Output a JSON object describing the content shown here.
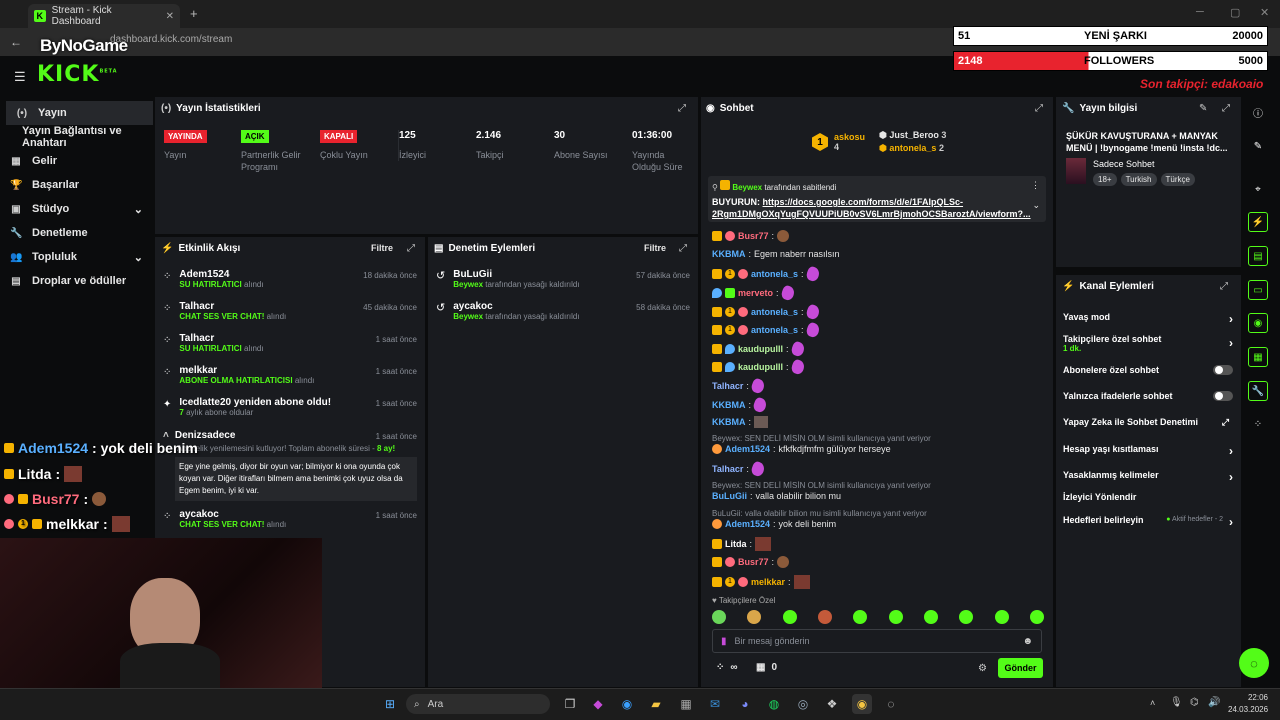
{
  "browser": {
    "tab_title": "Stream - Kick Dashboard",
    "url": "dashboard.kick.com/stream",
    "overlay_logo": "ByNoGame"
  },
  "overlay": {
    "song_count": "51",
    "song_label": "YENİ ŞARKI",
    "song_goal": "20000",
    "followers_count": "2148",
    "followers_label": "FOLLOWERS",
    "followers_goal": "5000",
    "last_follower": "Son takipçi: edakoaio"
  },
  "app": {
    "logo": "KICK",
    "logo_sup": "BETA"
  },
  "sidebar": {
    "items": [
      {
        "label": "Yayın",
        "icon": "(•)"
      },
      {
        "label": "Yayın Bağlantısı ve Anahtarı",
        "icon": ""
      },
      {
        "label": "Gelir",
        "icon": "▦"
      },
      {
        "label": "Başarılar",
        "icon": "🏆"
      },
      {
        "label": "Stüdyo",
        "icon": "▣"
      },
      {
        "label": "Denetleme",
        "icon": "🔧"
      },
      {
        "label": "Topluluk",
        "icon": "👥"
      },
      {
        "label": "Droplar ve ödüller",
        "icon": "▤"
      }
    ]
  },
  "stats": {
    "title": "Yayın İstatistikleri",
    "items": [
      {
        "badge": "YAYINDA",
        "label": "Yayın",
        "color": "#e8232e"
      },
      {
        "badge": "AÇIK",
        "label": "Partnerlik Gelir Programı",
        "color": "#53fc18"
      },
      {
        "badge": "KAPALI",
        "label": "Çoklu Yayın",
        "color": "#e8232e"
      },
      {
        "value": "125",
        "label": "İzleyici"
      },
      {
        "value": "2.146",
        "label": "Takipçi"
      },
      {
        "value": "30",
        "label": "Abone Sayısı"
      },
      {
        "value": "01:36:00",
        "label": "Yayında Olduğu Süre"
      }
    ]
  },
  "activity": {
    "title": "Etkinlik Akışı",
    "filter": "Filtre",
    "events": [
      {
        "name": "Adem1524",
        "sub": "SU HATIRLATICI",
        "suffix": "alındı",
        "time": "18 dakika önce"
      },
      {
        "name": "Talhacr",
        "sub": "CHAT SES VER CHAT!",
        "suffix": "alındı",
        "time": "45 dakika önce"
      },
      {
        "name": "Talhacr",
        "sub": "SU HATIRLATICI",
        "suffix": "alındı",
        "time": "1 saat önce"
      },
      {
        "name": "melkkar",
        "sub": "ABONE OLMA HATIRLATICISI",
        "suffix": "alındı",
        "time": "1 saat önce"
      },
      {
        "name": "Icedlatte20 yeniden abone oldu!",
        "sub": "7",
        "suffix": "aylık abone oldular",
        "time": "1 saat önce"
      }
    ],
    "resub": {
      "name": "Denizsadece",
      "time": "1 saat önce",
      "text": "Abonelik yenilemesini kutluyor! Toplam abonelik süresi -",
      "months": "8 ay!",
      "message": "Ege yine gelmiş, diyor bir oyun var; bilmiyor ki ona oyunda çok koyan var. Diğer itirafları bilmem ama benimki çok uyuz olsa da Egem benim, iyi ki var."
    },
    "last": {
      "name": "aycakoc",
      "sub": "CHAT SES VER CHAT!",
      "suffix": "alındı",
      "time": "1 saat önce"
    }
  },
  "moderation": {
    "title": "Denetim Eylemleri",
    "filter": "Filtre",
    "events": [
      {
        "name": "BuLuGii",
        "by": "Beywex",
        "suffix": "tarafından yasağı kaldırıldı",
        "time": "57 dakika önce"
      },
      {
        "name": "aycakoc",
        "by": "Beywex",
        "suffix": "tarafından yasağı kaldırıldı",
        "time": "58 dakika önce"
      }
    ]
  },
  "chat": {
    "title": "Sohbet",
    "top": [
      {
        "rank": "1",
        "name": "askosu",
        "count": "4"
      },
      {
        "name": "Just_Beroo",
        "count": "3"
      },
      {
        "name": "antonela_s",
        "count": "2"
      }
    ],
    "pinned_by": "Beywex",
    "pinned_suffix": "tarafından sabitlendi",
    "pinned_prefix": "BUYURUN:",
    "pinned_link": "https://docs.google.com/forms/d/e/1FAIpQLSc-2Rgm1DMgOXqYugFQVUUPiUB0vSV6LmrBjmohOCSBaroztA/viewform?...",
    "messages": [
      {
        "user": "Busr77",
        "color": "#ff6b7d",
        "text": ""
      },
      {
        "user": "KKBMA",
        "color": "#5ab0ff",
        "text": "Egem naberr nasılsın"
      },
      {
        "user": "antonela_s",
        "color": "#5ab0ff",
        "text": ""
      },
      {
        "user": "merveto",
        "color": "#ff6b7d",
        "text": ""
      },
      {
        "user": "antonela_s",
        "color": "#5ab0ff",
        "text": ""
      },
      {
        "user": "antonela_s",
        "color": "#5ab0ff",
        "text": ""
      },
      {
        "user": "kaudupulll",
        "color": "#b8f5a0",
        "text": ""
      },
      {
        "user": "kaudupulll",
        "color": "#b8f5a0",
        "text": ""
      },
      {
        "user": "Talhacr",
        "color": "#8fb4ff",
        "text": ""
      },
      {
        "user": "KKBMA",
        "color": "#5ab0ff",
        "text": ""
      },
      {
        "user": "KKBMA",
        "color": "#5ab0ff",
        "text": ""
      }
    ],
    "reply1": "Beywex: SEN DELİ MİSİN OLM isimli kullanıcıya yanıt veriyor",
    "msg_adem1": {
      "user": "Adem1524",
      "text": "kfkfkdjfmfm gülüyor herseye"
    },
    "msg_talha": {
      "user": "Talhacr",
      "text": ""
    },
    "reply2": "Beywex: SEN DELİ MİSİN OLM isimli kullanıcıya yanıt veriyor",
    "msg_bulu": {
      "user": "BuLuGii",
      "text": "valla olabilir bilion mu"
    },
    "reply3": "BuLuGii: valla olabilir bilion mu isimli kullanıcıya yanıt veriyor",
    "msg_adem2": {
      "user": "Adem1524",
      "text": "yok deli benim"
    },
    "msg_litda": {
      "user": "Litda",
      "text": ""
    },
    "msg_busr": {
      "user": "Busr77",
      "text": ""
    },
    "msg_melk": {
      "user": "melkkar",
      "text": ""
    },
    "followers_only": "Takipçilere Özel",
    "input_placeholder": "Bir mesaj gönderin",
    "points": "∞",
    "gifts": "0",
    "send": "Gönder"
  },
  "stream_info": {
    "title": "Yayın bilgisi",
    "stream_title": "ŞÜKÜR KAVUŞTURANA + MANYAK MENÜ | !bynogame !menü !insta !dc...",
    "category": "Sadece Sohbet",
    "tags": [
      "18+",
      "Turkish",
      "Türkçe"
    ]
  },
  "channel_actions": {
    "title": "Kanal Eylemleri",
    "items": [
      {
        "label": "Yavaş mod",
        "kind": "chevron"
      },
      {
        "label": "Takipçilere özel sohbet",
        "sub": "1 dk.",
        "kind": "chevron"
      },
      {
        "label": "Abonelere özel sohbet",
        "kind": "toggle"
      },
      {
        "label": "Yalnızca ifadelerle sohbet",
        "kind": "toggle"
      },
      {
        "label": "Yapay Zeka ile Sohbet Denetimi",
        "kind": "external"
      },
      {
        "label": "Hesap yaşı kısıtlaması",
        "kind": "chevron"
      },
      {
        "label": "Yasaklanmış kelimeler",
        "kind": "chevron"
      },
      {
        "label": "İzleyici Yönlendir",
        "kind": "none"
      },
      {
        "label": "Hedefleri belirleyin",
        "kind": "chevron",
        "extra": "Aktif hedefler - 2"
      }
    ]
  },
  "overlay_chat": [
    {
      "user": "Adem1524",
      "text": ": yok deli benim",
      "color": "#5ab0ff"
    },
    {
      "user": "Litda",
      "text": " :",
      "color": "#ffffff"
    },
    {
      "user": "Busr77",
      "text": " :",
      "color": "#ff6b7d"
    },
    {
      "user": "melkkar",
      "text": " :",
      "color": "#ffffff"
    }
  ],
  "taskbar": {
    "search": "Ara",
    "time": "22:06",
    "date": "24.03.2026"
  }
}
